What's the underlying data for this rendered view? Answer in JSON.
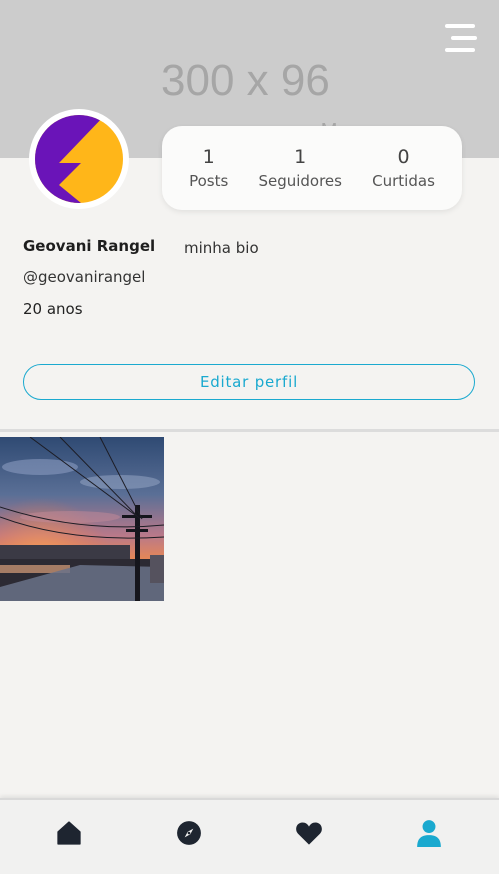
{
  "header": {
    "cover_placeholder": "300 x 96",
    "cover_placeholder_trailing": "M",
    "menu_icon": "hamburger-menu-icon"
  },
  "profile": {
    "name": "Geovani Rangel",
    "bio": "minha bio",
    "handle": "@geovanirangel",
    "age": "20 anos",
    "avatar_colors": {
      "purple": "#6a14b8",
      "yellow": "#ffb619"
    }
  },
  "stats": [
    {
      "value": "1",
      "label": "Posts"
    },
    {
      "value": "1",
      "label": "Seguidores"
    },
    {
      "value": "0",
      "label": "Curtidas"
    }
  ],
  "actions": {
    "edit_profile_label": "Editar perfil"
  },
  "posts": [
    {
      "description": "sunset-power-lines"
    }
  ],
  "bottom_nav": [
    {
      "icon": "home-icon",
      "active": false
    },
    {
      "icon": "compass-icon",
      "active": false
    },
    {
      "icon": "heart-icon",
      "active": false
    },
    {
      "icon": "user-icon",
      "active": true
    }
  ],
  "colors": {
    "accent": "#1aa9cf",
    "nav_icon": "#1e2530"
  }
}
